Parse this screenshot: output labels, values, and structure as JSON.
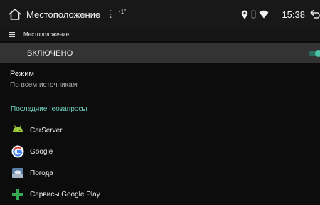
{
  "status_bar": {
    "title": "Местоположение",
    "overflow_glyph": "⋮",
    "superscript": "·1°",
    "time": "15:38"
  },
  "toolbar": {
    "title": "Местоположение"
  },
  "location_switch": {
    "label": "ВКЛЮЧЕНО",
    "enabled": true
  },
  "mode": {
    "title": "Режим",
    "value": "По всем источникам"
  },
  "recent_requests": {
    "header": "Последние геозапросы",
    "apps": [
      {
        "label": "CarServer",
        "icon": "android-icon"
      },
      {
        "label": "Google",
        "icon": "google-icon"
      },
      {
        "label": "Погода",
        "icon": "weather-icon"
      },
      {
        "label": "Сервисы Google Play",
        "icon": "plus-icon"
      }
    ]
  },
  "colors": {
    "accent": "#4fc3a9",
    "section_header": "#6fd3c0",
    "switch_bar": "#333333",
    "background": "#0c0c0c"
  }
}
